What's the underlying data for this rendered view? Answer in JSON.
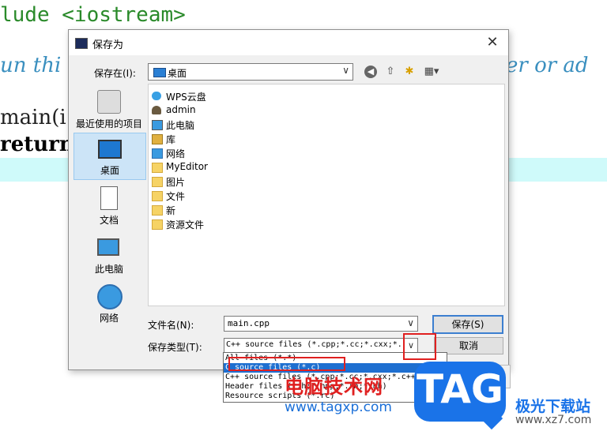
{
  "editor": {
    "line_include": "lude <iostream>",
    "line_comment": "un thi",
    "line_comment_right": "er or ad",
    "line_main": "main(i",
    "line_return": "return"
  },
  "dialog": {
    "title": "保存为",
    "close_glyph": "✕",
    "save_in_label": "保存在(I):",
    "save_in_value": "桌面",
    "toolbar_icons": [
      "back-icon",
      "up-folder-icon",
      "new-folder-icon",
      "view-menu-icon"
    ],
    "places": [
      {
        "label": "最近使用的项目",
        "icon": "recent-items-icon"
      },
      {
        "label": "桌面",
        "icon": "desktop-icon"
      },
      {
        "label": "文档",
        "icon": "documents-icon"
      },
      {
        "label": "此电脑",
        "icon": "this-pc-icon"
      },
      {
        "label": "网络",
        "icon": "network-icon"
      }
    ],
    "files": [
      {
        "name": "WPS云盘",
        "icon": "cloud-icon"
      },
      {
        "name": "admin",
        "icon": "user-icon"
      },
      {
        "name": "此电脑",
        "icon": "pc-icon"
      },
      {
        "name": "库",
        "icon": "library-icon"
      },
      {
        "name": "网络",
        "icon": "network-icon"
      },
      {
        "name": "MyEditor",
        "icon": "folder-icon"
      },
      {
        "name": "图片",
        "icon": "folder-icon"
      },
      {
        "name": "文件",
        "icon": "folder-icon"
      },
      {
        "name": "新",
        "icon": "folder-icon"
      },
      {
        "name": "资源文件",
        "icon": "folder-icon"
      }
    ],
    "file_name_label": "文件名(N):",
    "file_name_value": "main.cpp",
    "file_type_label": "保存类型(T):",
    "file_type_value": "C++ source files (*.cpp;*.cc;*.cxx;*.",
    "save_button": "保存(S)",
    "cancel_button": "取消",
    "type_options": [
      "All files (*.*)",
      "C source files (*.c)",
      "C++ source files (*.cpp;*.cc;*.cxx;*.c++;*.cp)",
      "Header files (*.h;*.hpp;*.rh;*.hh)",
      "Resource scripts (*.rc)"
    ],
    "selected_type_index": 1
  },
  "watermark": {
    "cn_text": "电脑技术网",
    "url": "www.tagxp.com",
    "logo": "TAG",
    "site_cn": "极光下载站",
    "site_url": "www.xz7.com"
  },
  "colors": {
    "accent": "#1e6fd0",
    "annotation_red": "#e02020",
    "highlight_band": "#cffafa"
  }
}
